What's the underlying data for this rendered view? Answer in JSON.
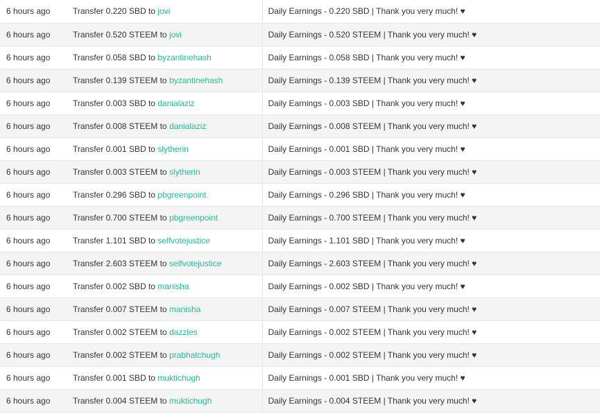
{
  "transfers": [
    {
      "time": "6 hours ago",
      "prefix": "Transfer 0.220 SBD to",
      "account": "jovi",
      "memo": "Daily Earnings - 0.220 SBD | Thank you very much! ♥"
    },
    {
      "time": "6 hours ago",
      "prefix": "Transfer 0.520 STEEM to",
      "account": "jovi",
      "memo": "Daily Earnings - 0.520 STEEM | Thank you very much! ♥"
    },
    {
      "time": "6 hours ago",
      "prefix": "Transfer 0.058 SBD to",
      "account": "byzantinehash",
      "memo": "Daily Earnings - 0.058 SBD | Thank you very much! ♥"
    },
    {
      "time": "6 hours ago",
      "prefix": "Transfer 0.139 STEEM to",
      "account": "byzantinehash",
      "memo": "Daily Earnings - 0.139 STEEM | Thank you very much! ♥"
    },
    {
      "time": "6 hours ago",
      "prefix": "Transfer 0.003 SBD to",
      "account": "danialaziz",
      "memo": "Daily Earnings - 0.003 SBD | Thank you very much! ♥"
    },
    {
      "time": "6 hours ago",
      "prefix": "Transfer 0.008 STEEM to",
      "account": "danialaziz",
      "memo": "Daily Earnings - 0.008 STEEM | Thank you very much! ♥"
    },
    {
      "time": "6 hours ago",
      "prefix": "Transfer 0.001 SBD to",
      "account": "slytherin",
      "memo": "Daily Earnings - 0.001 SBD | Thank you very much! ♥"
    },
    {
      "time": "6 hours ago",
      "prefix": "Transfer 0.003 STEEM to",
      "account": "slytherin",
      "memo": "Daily Earnings - 0.003 STEEM | Thank you very much! ♥"
    },
    {
      "time": "6 hours ago",
      "prefix": "Transfer 0.296 SBD to",
      "account": "pbgreenpoint",
      "memo": "Daily Earnings - 0.296 SBD | Thank you very much! ♥"
    },
    {
      "time": "6 hours ago",
      "prefix": "Transfer 0.700 STEEM to",
      "account": "pbgreenpoint",
      "memo": "Daily Earnings - 0.700 STEEM | Thank you very much! ♥"
    },
    {
      "time": "6 hours ago",
      "prefix": "Transfer 1.101 SBD to",
      "account": "selfvotejustice",
      "memo": "Daily Earnings - 1.101 SBD | Thank you very much! ♥"
    },
    {
      "time": "6 hours ago",
      "prefix": "Transfer 2.603 STEEM to",
      "account": "selfvotejustice",
      "memo": "Daily Earnings - 2.603 STEEM | Thank you very much! ♥"
    },
    {
      "time": "6 hours ago",
      "prefix": "Transfer 0.002 SBD to",
      "account": "manisha",
      "memo": "Daily Earnings - 0.002 SBD | Thank you very much! ♥"
    },
    {
      "time": "6 hours ago",
      "prefix": "Transfer 0.007 STEEM to",
      "account": "manisha",
      "memo": "Daily Earnings - 0.007 STEEM | Thank you very much! ♥"
    },
    {
      "time": "6 hours ago",
      "prefix": "Transfer 0.002 STEEM to",
      "account": "dazzles",
      "memo": "Daily Earnings - 0.002 STEEM | Thank you very much! ♥"
    },
    {
      "time": "6 hours ago",
      "prefix": "Transfer 0.002 STEEM to",
      "account": "prabhatchugh",
      "memo": "Daily Earnings - 0.002 STEEM | Thank you very much! ♥"
    },
    {
      "time": "6 hours ago",
      "prefix": "Transfer 0.001 SBD to",
      "account": "muktichugh",
      "memo": "Daily Earnings - 0.001 SBD | Thank you very much! ♥"
    },
    {
      "time": "6 hours ago",
      "prefix": "Transfer 0.004 STEEM to",
      "account": "muktichugh",
      "memo": "Daily Earnings - 0.004 STEEM | Thank you very much! ♥"
    }
  ],
  "colors": {
    "link": "#1fbf8f",
    "row_stripe": "#f4f4f4"
  }
}
